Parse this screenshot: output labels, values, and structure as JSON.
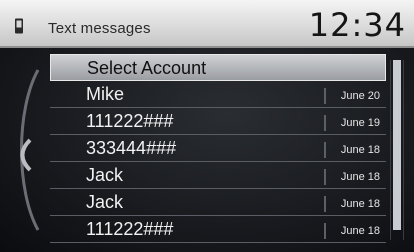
{
  "header": {
    "title": "Text messages",
    "time": "12:34",
    "phone_icon": "phone-icon"
  },
  "list": {
    "select_account_label": "Select Account",
    "items": [
      {
        "name": "Mike",
        "date": "June 20"
      },
      {
        "name": "111222###",
        "date": "June 19"
      },
      {
        "name": "333444###",
        "date": "June 18"
      },
      {
        "name": "Jack",
        "date": "June 18"
      },
      {
        "name": "Jack",
        "date": "June 18"
      },
      {
        "name": "111222###",
        "date": "June 18"
      }
    ]
  }
}
